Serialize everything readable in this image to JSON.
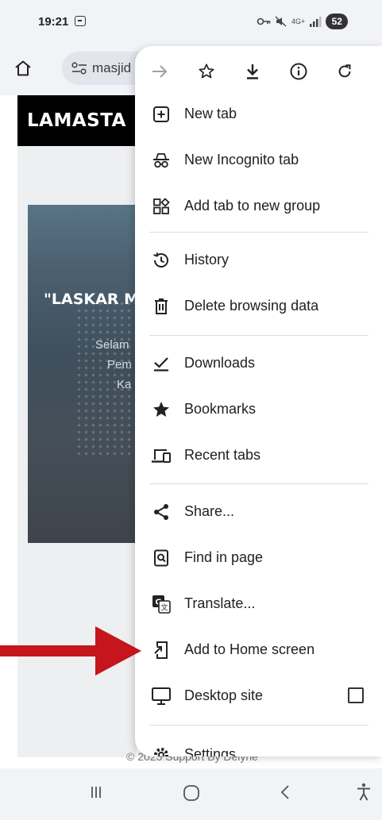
{
  "status_bar": {
    "time": "19:21",
    "battery": "52",
    "network": "4G+"
  },
  "address_bar": {
    "url_text": "masjid"
  },
  "page": {
    "logo": "LAMASTA",
    "hero_title": "\"LASKAR M",
    "hero_line1": "Selam",
    "hero_line2": "Pem",
    "hero_line3": "Ka",
    "footer": "© 2025 Support By Delyne"
  },
  "menu": {
    "toolbar": [
      "forward-icon",
      "bookmark-star-icon",
      "download-icon",
      "info-icon",
      "refresh-icon"
    ],
    "items": [
      {
        "label": "New tab",
        "icon": "new-tab-icon"
      },
      {
        "label": "New Incognito tab",
        "icon": "incognito-icon"
      },
      {
        "label": "Add tab to new group",
        "icon": "tab-group-icon"
      },
      {
        "label": "History",
        "icon": "history-icon"
      },
      {
        "label": "Delete browsing data",
        "icon": "trash-icon"
      },
      {
        "label": "Downloads",
        "icon": "downloads-check-icon"
      },
      {
        "label": "Bookmarks",
        "icon": "star-filled-icon"
      },
      {
        "label": "Recent tabs",
        "icon": "devices-icon"
      },
      {
        "label": "Share...",
        "icon": "share-icon"
      },
      {
        "label": "Find in page",
        "icon": "find-in-page-icon"
      },
      {
        "label": "Translate...",
        "icon": "translate-icon"
      },
      {
        "label": "Add to Home screen",
        "icon": "add-to-home-icon"
      },
      {
        "label": "Desktop site",
        "icon": "desktop-icon"
      },
      {
        "label": "Settings",
        "icon": "settings-icon"
      }
    ],
    "desktop_site_checked": false
  },
  "annotation": {
    "arrow_color": "#c4161c"
  },
  "colors": {
    "chrome_bg": "#f1f3f6",
    "menu_bg": "#ffffff",
    "text": "#1f1f1f"
  }
}
